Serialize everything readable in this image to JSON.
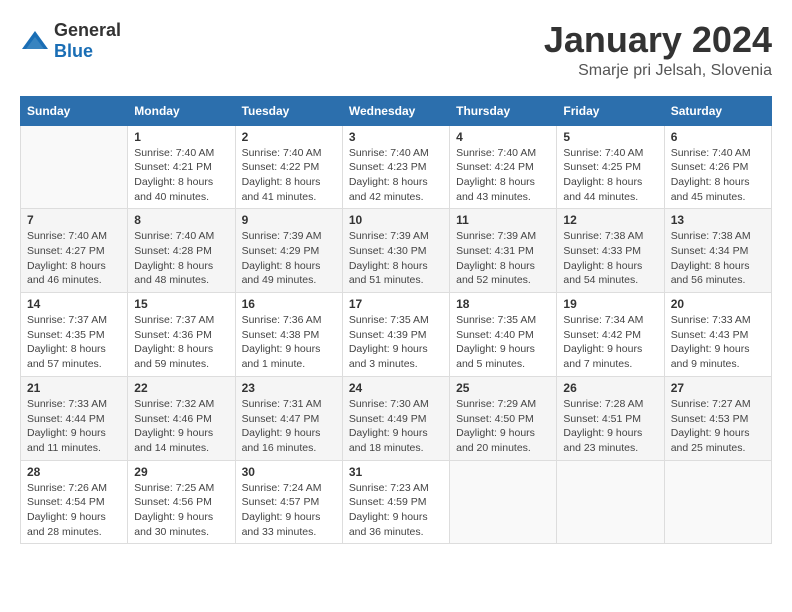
{
  "header": {
    "logo_general": "General",
    "logo_blue": "Blue",
    "month_title": "January 2024",
    "location": "Smarje pri Jelsah, Slovenia"
  },
  "calendar": {
    "days_of_week": [
      "Sunday",
      "Monday",
      "Tuesday",
      "Wednesday",
      "Thursday",
      "Friday",
      "Saturday"
    ],
    "weeks": [
      [
        {
          "day": "",
          "info": ""
        },
        {
          "day": "1",
          "info": "Sunrise: 7:40 AM\nSunset: 4:21 PM\nDaylight: 8 hours\nand 40 minutes."
        },
        {
          "day": "2",
          "info": "Sunrise: 7:40 AM\nSunset: 4:22 PM\nDaylight: 8 hours\nand 41 minutes."
        },
        {
          "day": "3",
          "info": "Sunrise: 7:40 AM\nSunset: 4:23 PM\nDaylight: 8 hours\nand 42 minutes."
        },
        {
          "day": "4",
          "info": "Sunrise: 7:40 AM\nSunset: 4:24 PM\nDaylight: 8 hours\nand 43 minutes."
        },
        {
          "day": "5",
          "info": "Sunrise: 7:40 AM\nSunset: 4:25 PM\nDaylight: 8 hours\nand 44 minutes."
        },
        {
          "day": "6",
          "info": "Sunrise: 7:40 AM\nSunset: 4:26 PM\nDaylight: 8 hours\nand 45 minutes."
        }
      ],
      [
        {
          "day": "7",
          "info": "Sunrise: 7:40 AM\nSunset: 4:27 PM\nDaylight: 8 hours\nand 46 minutes."
        },
        {
          "day": "8",
          "info": "Sunrise: 7:40 AM\nSunset: 4:28 PM\nDaylight: 8 hours\nand 48 minutes."
        },
        {
          "day": "9",
          "info": "Sunrise: 7:39 AM\nSunset: 4:29 PM\nDaylight: 8 hours\nand 49 minutes."
        },
        {
          "day": "10",
          "info": "Sunrise: 7:39 AM\nSunset: 4:30 PM\nDaylight: 8 hours\nand 51 minutes."
        },
        {
          "day": "11",
          "info": "Sunrise: 7:39 AM\nSunset: 4:31 PM\nDaylight: 8 hours\nand 52 minutes."
        },
        {
          "day": "12",
          "info": "Sunrise: 7:38 AM\nSunset: 4:33 PM\nDaylight: 8 hours\nand 54 minutes."
        },
        {
          "day": "13",
          "info": "Sunrise: 7:38 AM\nSunset: 4:34 PM\nDaylight: 8 hours\nand 56 minutes."
        }
      ],
      [
        {
          "day": "14",
          "info": "Sunrise: 7:37 AM\nSunset: 4:35 PM\nDaylight: 8 hours\nand 57 minutes."
        },
        {
          "day": "15",
          "info": "Sunrise: 7:37 AM\nSunset: 4:36 PM\nDaylight: 8 hours\nand 59 minutes."
        },
        {
          "day": "16",
          "info": "Sunrise: 7:36 AM\nSunset: 4:38 PM\nDaylight: 9 hours\nand 1 minute."
        },
        {
          "day": "17",
          "info": "Sunrise: 7:35 AM\nSunset: 4:39 PM\nDaylight: 9 hours\nand 3 minutes."
        },
        {
          "day": "18",
          "info": "Sunrise: 7:35 AM\nSunset: 4:40 PM\nDaylight: 9 hours\nand 5 minutes."
        },
        {
          "day": "19",
          "info": "Sunrise: 7:34 AM\nSunset: 4:42 PM\nDaylight: 9 hours\nand 7 minutes."
        },
        {
          "day": "20",
          "info": "Sunrise: 7:33 AM\nSunset: 4:43 PM\nDaylight: 9 hours\nand 9 minutes."
        }
      ],
      [
        {
          "day": "21",
          "info": "Sunrise: 7:33 AM\nSunset: 4:44 PM\nDaylight: 9 hours\nand 11 minutes."
        },
        {
          "day": "22",
          "info": "Sunrise: 7:32 AM\nSunset: 4:46 PM\nDaylight: 9 hours\nand 14 minutes."
        },
        {
          "day": "23",
          "info": "Sunrise: 7:31 AM\nSunset: 4:47 PM\nDaylight: 9 hours\nand 16 minutes."
        },
        {
          "day": "24",
          "info": "Sunrise: 7:30 AM\nSunset: 4:49 PM\nDaylight: 9 hours\nand 18 minutes."
        },
        {
          "day": "25",
          "info": "Sunrise: 7:29 AM\nSunset: 4:50 PM\nDaylight: 9 hours\nand 20 minutes."
        },
        {
          "day": "26",
          "info": "Sunrise: 7:28 AM\nSunset: 4:51 PM\nDaylight: 9 hours\nand 23 minutes."
        },
        {
          "day": "27",
          "info": "Sunrise: 7:27 AM\nSunset: 4:53 PM\nDaylight: 9 hours\nand 25 minutes."
        }
      ],
      [
        {
          "day": "28",
          "info": "Sunrise: 7:26 AM\nSunset: 4:54 PM\nDaylight: 9 hours\nand 28 minutes."
        },
        {
          "day": "29",
          "info": "Sunrise: 7:25 AM\nSunset: 4:56 PM\nDaylight: 9 hours\nand 30 minutes."
        },
        {
          "day": "30",
          "info": "Sunrise: 7:24 AM\nSunset: 4:57 PM\nDaylight: 9 hours\nand 33 minutes."
        },
        {
          "day": "31",
          "info": "Sunrise: 7:23 AM\nSunset: 4:59 PM\nDaylight: 9 hours\nand 36 minutes."
        },
        {
          "day": "",
          "info": ""
        },
        {
          "day": "",
          "info": ""
        },
        {
          "day": "",
          "info": ""
        }
      ]
    ]
  }
}
